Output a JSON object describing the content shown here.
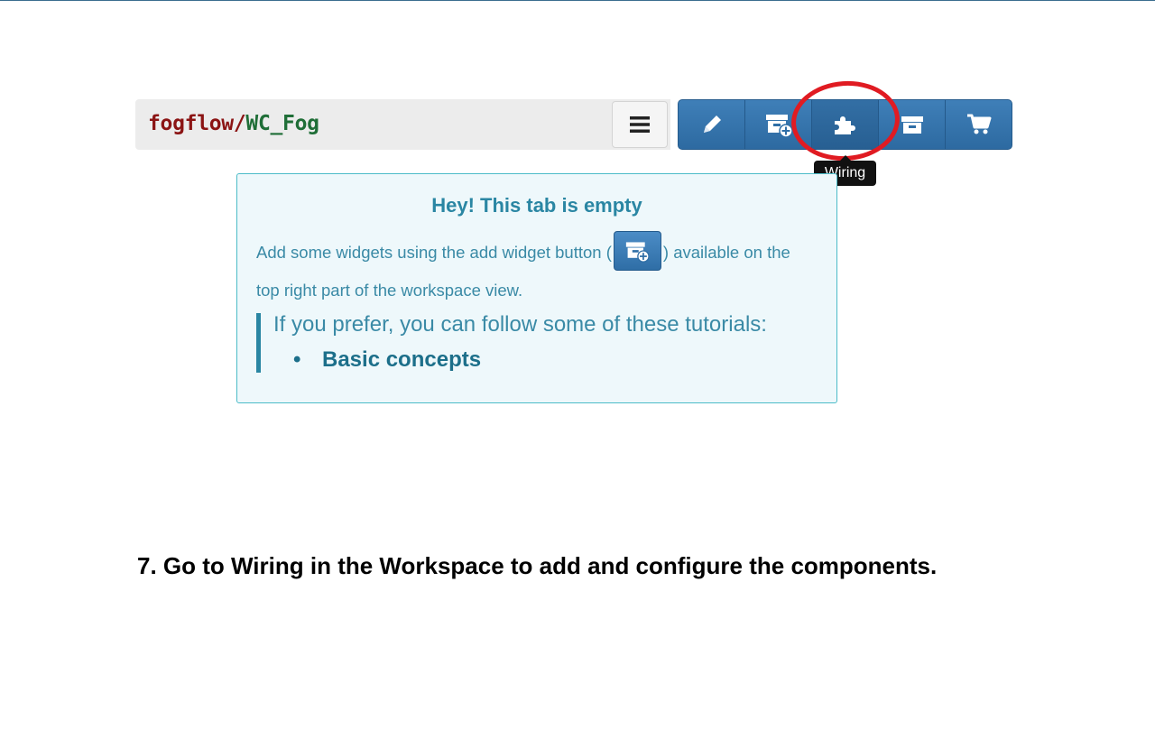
{
  "workspace": {
    "owner": "fogflow",
    "separator": "/",
    "name": "WC_Fog"
  },
  "toolbar": {
    "buttons": [
      {
        "icon": "pencil-icon",
        "state": "normal"
      },
      {
        "icon": "add-widget-icon",
        "state": "normal"
      },
      {
        "icon": "puzzle-piece-icon",
        "state": "hovered"
      },
      {
        "icon": "archive-icon",
        "state": "normal"
      },
      {
        "icon": "shopping-cart-icon",
        "state": "normal"
      }
    ],
    "tooltip": "Wiring",
    "highlight_color": "#e01b22"
  },
  "empty_tab": {
    "title": "Hey! This tab is empty",
    "text_before": "Add some widgets using the add widget button (",
    "text_after": ") available on the top right part of the workspace view.",
    "tutorials_lead": "If you prefer, you can follow some of these tutorials:",
    "tutorials": [
      "Basic concepts"
    ]
  },
  "caption": "7. Go to Wiring in the Workspace to add and configure the components."
}
